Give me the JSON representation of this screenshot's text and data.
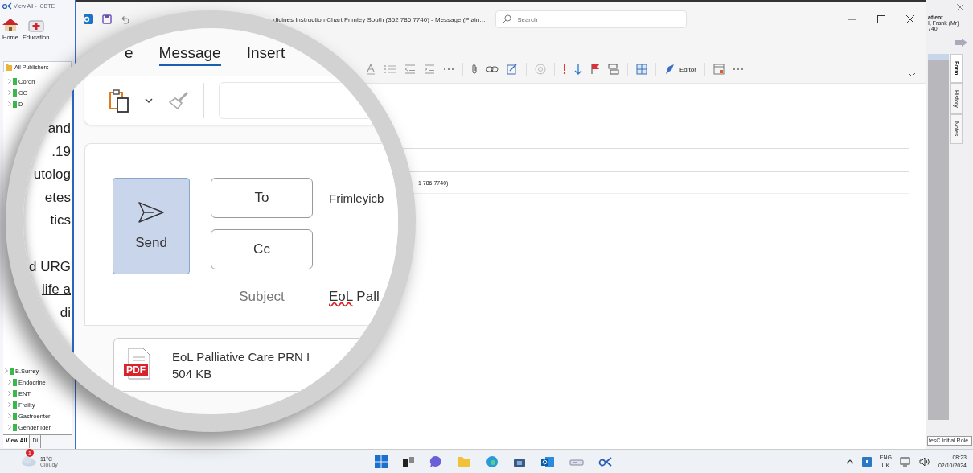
{
  "records_app": {
    "title": "View All - ICBTE",
    "toolbar": [
      {
        "label": "Home",
        "kind": "house"
      },
      {
        "label": "Education",
        "kind": "kit"
      }
    ],
    "publishers_header": "All Publishers",
    "tree_top": [
      {
        "label": "Coron"
      },
      {
        "label": "CO"
      },
      {
        "label": "D"
      }
    ],
    "tree_bottom": [
      {
        "label": "B.Surrey"
      },
      {
        "label": "Endocrine"
      },
      {
        "label": "ENT"
      },
      {
        "label": "Frailty"
      },
      {
        "label": "Gastroenter"
      },
      {
        "label": "Gender Ider"
      }
    ],
    "bottom_tabs": [
      {
        "label": "View All",
        "selected": true
      },
      {
        "label": "Di",
        "selected": false
      }
    ]
  },
  "message_window": {
    "title": "dicines Instruction Chart Frimley South (352 786 7740) - Message (Plain…",
    "search": {
      "placeholder": "Search"
    },
    "editor_label": "Editor",
    "recipient_line": "1 786 7740)"
  },
  "side_panel": {
    "heading": "atient",
    "patient_name": "I, Frank (Mr)",
    "patient_id": "740",
    "tabs": [
      {
        "label": "Form",
        "selected": true
      },
      {
        "label": "History",
        "selected": false
      },
      {
        "label": "Notes",
        "selected": false
      }
    ],
    "footer": "tesC Initial Role"
  },
  "magnifier": {
    "sidebar_fragments": [
      [
        {
          "text": "and",
          "underlined": false
        },
        {
          "text": ".19",
          "underlined": false
        },
        {
          "text": "utolog",
          "underlined": false
        },
        {
          "text": "etes",
          "underlined": false
        },
        {
          "text": "tics",
          "underlined": false
        }
      ],
      [
        {
          "text": "d URG",
          "underlined": false
        },
        {
          "text": "life a",
          "underlined": true
        },
        {
          "text": "di",
          "underlined": false
        }
      ]
    ],
    "ribbon_tabs": [
      {
        "label": "e",
        "selected": false
      },
      {
        "label": "Message",
        "selected": true
      },
      {
        "label": "Insert",
        "selected": false
      }
    ],
    "send_button": "Send",
    "to_button": "To",
    "cc_button": "Cc",
    "to_value": "Frimleyicb",
    "subject_label": "Subject",
    "subject_value": [
      {
        "text": "EoL",
        "misspelled": true
      },
      {
        "text": " Pall",
        "misspelled": false
      }
    ],
    "attachment": {
      "badge": "PDF",
      "name": "EoL Palliative Care PRN I",
      "size": "504 KB"
    }
  },
  "taskbar": {
    "weather": {
      "badge": "1",
      "temperature": "11°C",
      "condition": "Cloudy"
    },
    "language": "ENG",
    "layout": "UK",
    "time": "08:23",
    "date": "02/10/2024"
  }
}
